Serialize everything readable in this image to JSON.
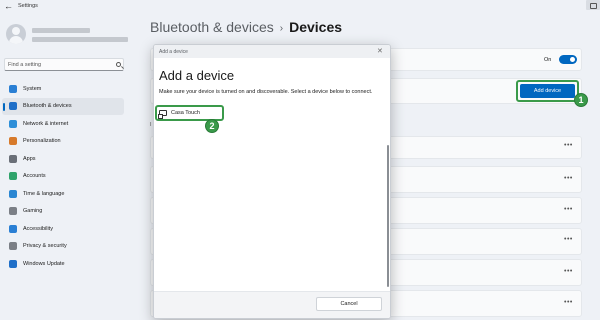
{
  "window": {
    "title": "Settings"
  },
  "sidebar": {
    "search_placeholder": "Find a setting",
    "items": [
      {
        "label": "System",
        "icon": "monitor-icon",
        "color": "#2a7fd4"
      },
      {
        "label": "Bluetooth & devices",
        "icon": "bluetooth-icon",
        "color": "#1f6fc8",
        "selected": true
      },
      {
        "label": "Network & internet",
        "icon": "wifi-icon",
        "color": "#2e8fd8"
      },
      {
        "label": "Personalization",
        "icon": "brush-icon",
        "color": "#d77a2b"
      },
      {
        "label": "Apps",
        "icon": "apps-icon",
        "color": "#6a6f78"
      },
      {
        "label": "Accounts",
        "icon": "person-icon",
        "color": "#2fa36b"
      },
      {
        "label": "Time & language",
        "icon": "globe-clock-icon",
        "color": "#2a86d2"
      },
      {
        "label": "Gaming",
        "icon": "controller-icon",
        "color": "#7b7f86"
      },
      {
        "label": "Accessibility",
        "icon": "accessibility-icon",
        "color": "#2a7fd4"
      },
      {
        "label": "Privacy & security",
        "icon": "shield-icon",
        "color": "#7b7f86"
      },
      {
        "label": "Windows Update",
        "icon": "update-icon",
        "color": "#1f6fc8"
      }
    ]
  },
  "header": {
    "parent": "Bluetooth & devices",
    "separator": "›",
    "current": "Devices"
  },
  "main": {
    "bluetooth_state": "On",
    "add_device_label": "Add device",
    "section_fragment": "I",
    "more_label": "•••"
  },
  "dialog": {
    "window_title": "Add a device",
    "close_glyph": "✕",
    "heading": "Add a device",
    "description": "Make sure your device is turned on and discoverable. Select a device below to connect.",
    "device_name": "Casa Touch",
    "cancel_label": "Cancel"
  },
  "annotations": {
    "step1": "1",
    "step2": "2",
    "color": "#3a9a4a"
  },
  "colors": {
    "accent": "#0067c0"
  }
}
